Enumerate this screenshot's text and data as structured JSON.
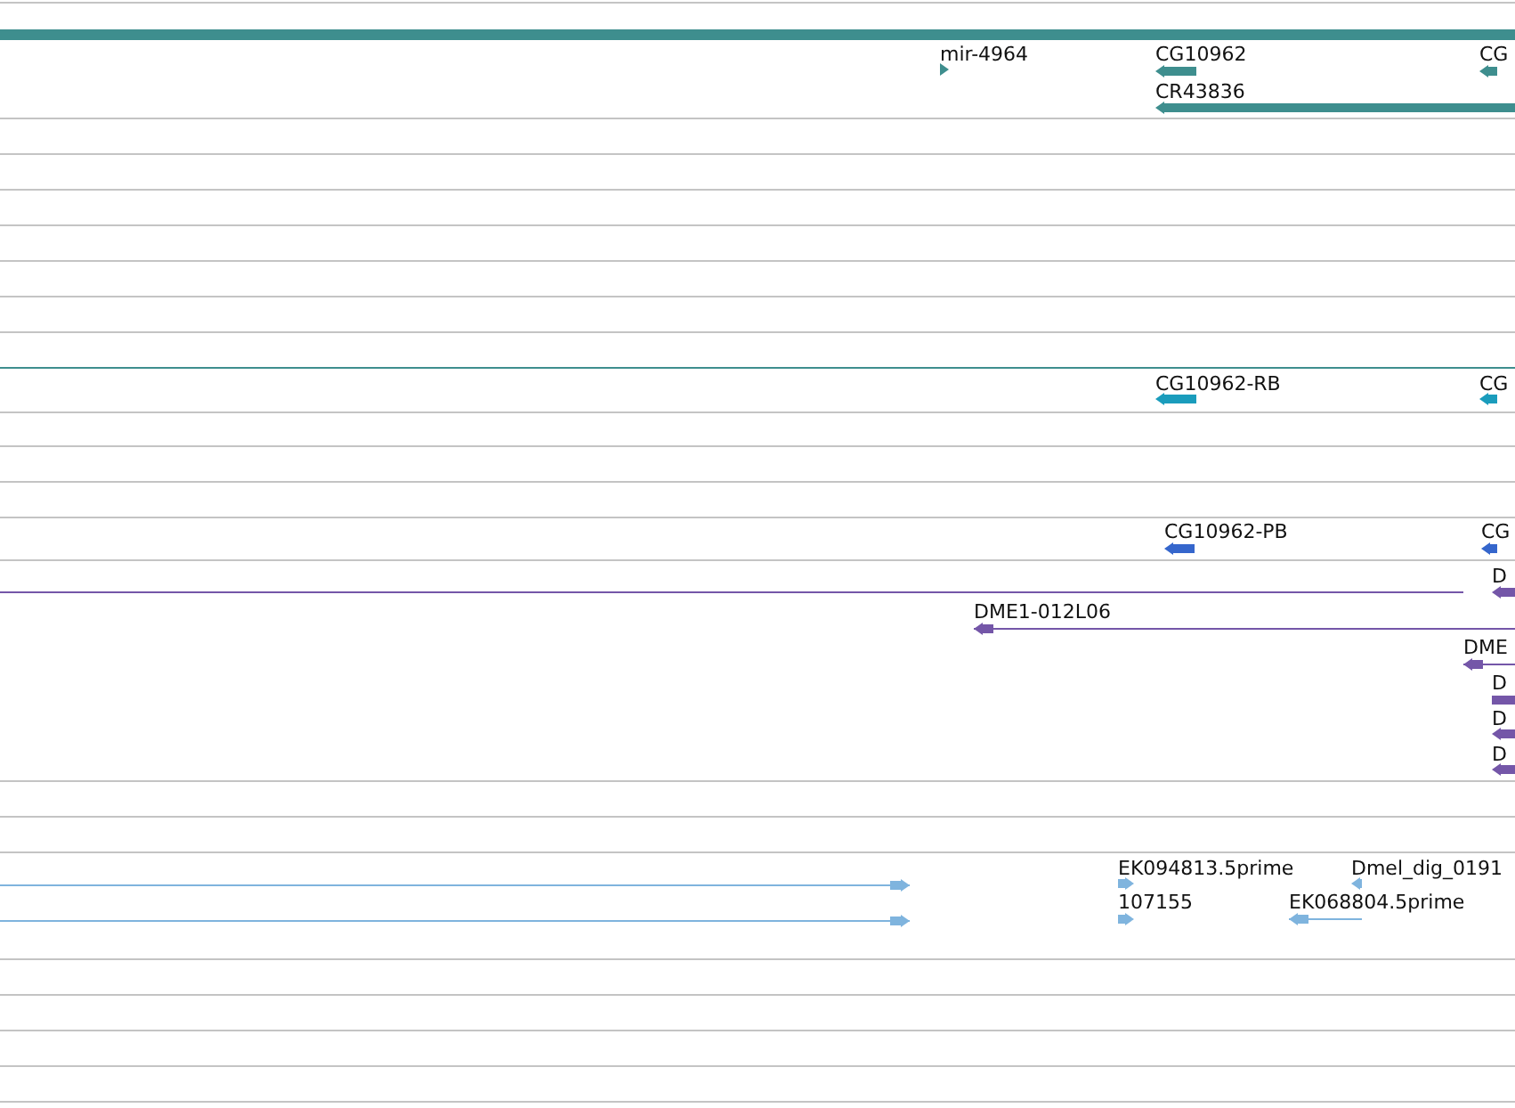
{
  "tracks": [
    {
      "color": "#3e8e8e",
      "features": [
        {
          "label": "mir-4964",
          "reverse": false
        },
        {
          "label": "CG10962",
          "reverse": true
        },
        {
          "label": "CG",
          "reverse": true
        },
        {
          "label": "CR43836",
          "reverse": true
        }
      ]
    },
    {
      "color": "#1a9cbc",
      "features": [
        {
          "label": "CG10962-RB",
          "reverse": true
        },
        {
          "label": "CG",
          "reverse": true
        }
      ]
    },
    {
      "color": "#3566cc",
      "features": [
        {
          "label": "CG10962-PB",
          "reverse": true
        },
        {
          "label": "CG",
          "reverse": true
        }
      ]
    },
    {
      "color": "#7456a8",
      "features": [
        {
          "reverse": true
        },
        {
          "label": "D",
          "reverse": true
        }
      ]
    },
    {
      "color": "#7456a8",
      "features": [
        {
          "label": "DME1-012L06",
          "reverse": true
        },
        {
          "label": "DME",
          "reverse": true
        },
        {
          "label": "D",
          "reverse": false
        },
        {
          "label": "D",
          "reverse": true
        },
        {
          "label": "D",
          "reverse": true
        }
      ]
    },
    {
      "color": "#7fb4de",
      "features": [
        {
          "reverse": false
        },
        {
          "label": "EK094813.5prime",
          "reverse": false
        },
        {
          "label": "Dmel_dig_0191",
          "reverse": true
        }
      ]
    },
    {
      "color": "#7fb4de",
      "features": [
        {
          "reverse": false
        },
        {
          "label": "107155",
          "reverse": false
        },
        {
          "label": "EK068804.5prime",
          "reverse": true
        }
      ]
    }
  ]
}
